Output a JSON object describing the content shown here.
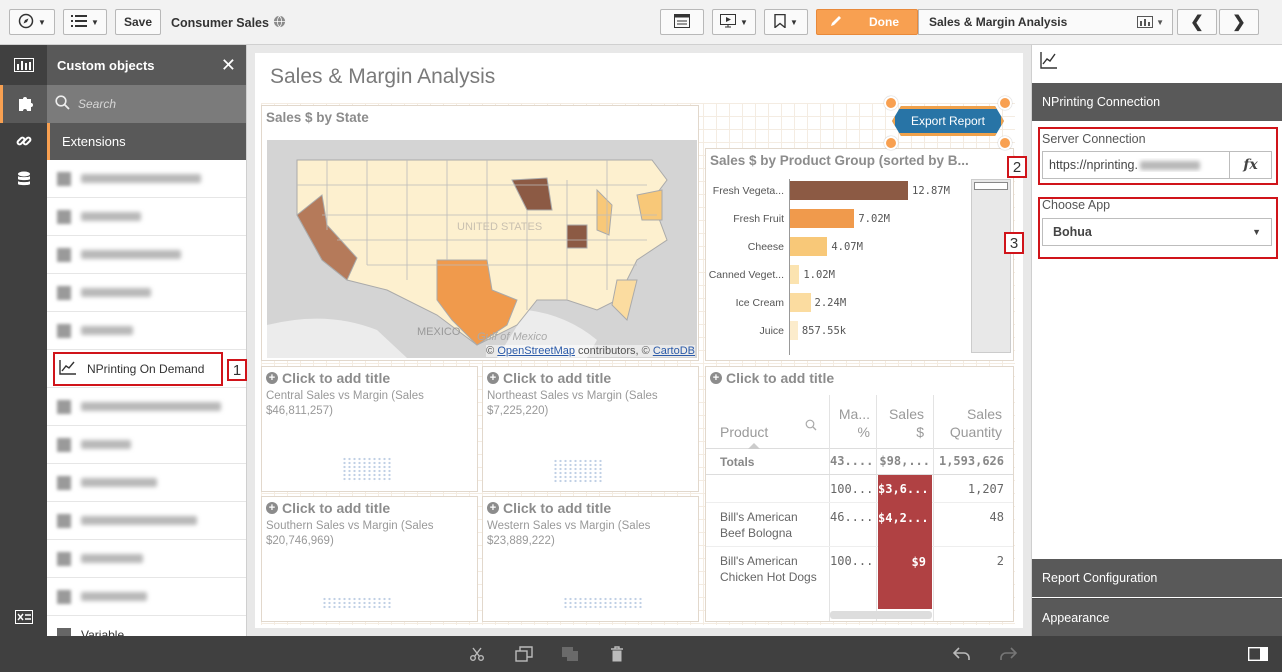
{
  "toolbar": {
    "save_label": "Save",
    "app_title": "Consumer Sales",
    "done_label": "Done",
    "sheet_title": "Sales & Margin Analysis"
  },
  "left_panel": {
    "title": "Custom objects",
    "search_placeholder": "Search",
    "extensions_tab": "Extensions",
    "highlighted_item": "NPrinting On Demand",
    "bottom_item": "Variable"
  },
  "sheet": {
    "title": "Sales & Margin Analysis",
    "map": {
      "title": "Sales $ by State",
      "label_us": "UNITED STATES OF AMERICA",
      "label_mexico": "MEXICO",
      "label_gulf": "Gulf of Mexico",
      "attribution_prefix": "©",
      "osm_link": "OpenStreetMap",
      "attribution_mid": "contributors, ©",
      "carto_link": "CartoDB"
    },
    "export_button": "Export Report",
    "bar_chart": {
      "title": "Sales $ by Product Group (sorted by B...",
      "rows": [
        {
          "label": "Fresh Vegeta...",
          "value_label": "12.87M",
          "value": 12.87,
          "color": "#8c5a44"
        },
        {
          "label": "Fresh Fruit",
          "value_label": "7.02M",
          "value": 7.02,
          "color": "#f09a4c"
        },
        {
          "label": "Cheese",
          "value_label": "4.07M",
          "value": 4.07,
          "color": "#f8c878"
        },
        {
          "label": "Canned Veget...",
          "value_label": "1.02M",
          "value": 1.02,
          "color": "#fbe3b0"
        },
        {
          "label": "Ice Cream",
          "value_label": "2.24M",
          "value": 2.24,
          "color": "#fbdca0"
        },
        {
          "label": "Juice",
          "value_label": "857.55k",
          "value": 0.85755,
          "color": "#fceccc"
        }
      ]
    },
    "scatter_cards": [
      {
        "add_title": "Click to add title",
        "subtitle": "Central Sales vs Margin (Sales $46,811,257)"
      },
      {
        "add_title": "Click to add title",
        "subtitle": "Northeast Sales vs Margin (Sales $7,225,220)"
      },
      {
        "add_title": "Click to add title",
        "subtitle": "Southern Sales vs Margin (Sales $20,746,969)"
      },
      {
        "add_title": "Click to add title",
        "subtitle": "Western Sales vs Margin (Sales $23,889,222)"
      }
    ],
    "table": {
      "add_title": "Click to add title",
      "headers": {
        "product": "Product",
        "margin": "Ma... %",
        "sales": "Sales $",
        "qty": "Sales Quantity"
      },
      "totals": {
        "label": "Totals",
        "margin": "43....",
        "sales": "$98,...",
        "qty": "1,593,626"
      },
      "rows": [
        {
          "product": "",
          "margin": "100...",
          "sales": "$3,6...",
          "qty": "1,207"
        },
        {
          "product": "Bill's American Beef Bologna",
          "margin": "46....",
          "sales": "$4,2...",
          "qty": "48"
        },
        {
          "product": "Bill's American Chicken Hot Dogs",
          "margin": "100...",
          "sales": "$9",
          "qty": "2"
        }
      ]
    }
  },
  "properties": {
    "nprinting_section": "NPrinting Connection",
    "server_label": "Server Connection",
    "server_value": "https://nprinting.",
    "fx_label": "fx",
    "app_label": "Choose App",
    "app_value": "Bohua",
    "report_config": "Report Configuration",
    "appearance": "Appearance"
  },
  "annotations": {
    "one": "1",
    "two": "2",
    "three": "3"
  },
  "colors": {
    "accent": "#f8a051",
    "panel_dark": "#595959",
    "highlight_red": "#d0141a",
    "table_red": "#b04143",
    "export_blue": "#2874a6"
  }
}
